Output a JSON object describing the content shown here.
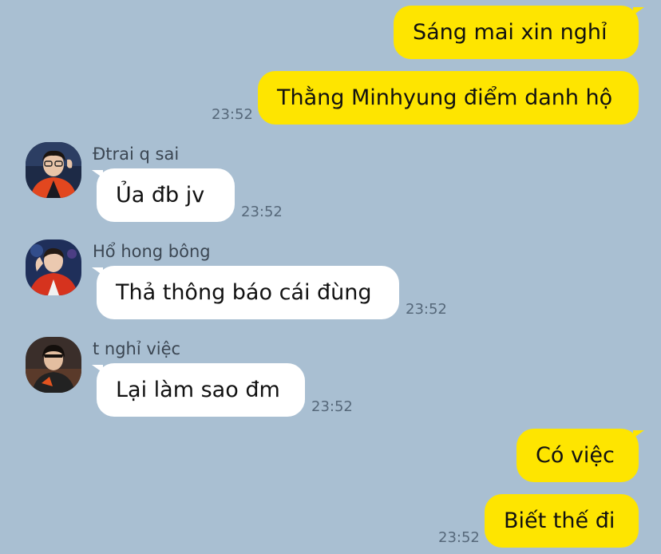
{
  "colors": {
    "background": "#a9bfd2",
    "outgoing_bubble": "#fee500",
    "incoming_bubble": "#ffffff",
    "timestamp": "#56687a"
  },
  "messages": [
    {
      "direction": "outgoing",
      "text": "Sáng mai xin nghỉ"
    },
    {
      "direction": "outgoing",
      "text": "Thằng Minhyung điểm danh hộ",
      "time": "23:52"
    },
    {
      "direction": "incoming",
      "sender": "Đtrai q sai",
      "avatar": "avatar-photo",
      "text": "Ủa đb jv",
      "time": "23:52"
    },
    {
      "direction": "incoming",
      "sender": "Hổ hong bông",
      "avatar": "avatar-photo",
      "text": "Thả thông báo cái đùng",
      "time": "23:52"
    },
    {
      "direction": "incoming",
      "sender": "t nghỉ việc",
      "avatar": "avatar-photo",
      "text": "Lại làm sao đm",
      "time": "23:52"
    },
    {
      "direction": "outgoing",
      "text": "Có việc"
    },
    {
      "direction": "outgoing",
      "text": "Biết thế đi",
      "time": "23:52"
    }
  ]
}
